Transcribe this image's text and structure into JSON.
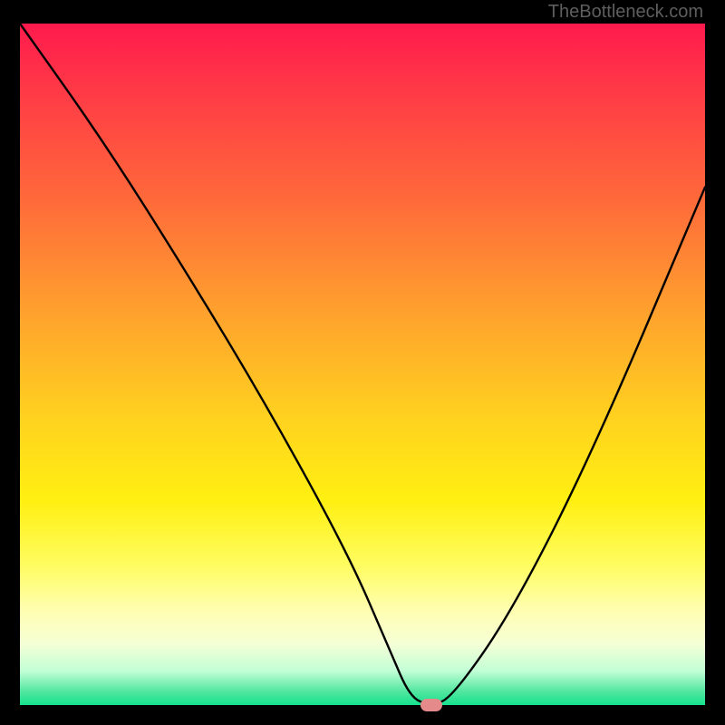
{
  "watermark": "TheBottleneck.com",
  "chart_data": {
    "type": "line",
    "title": "",
    "xlabel": "",
    "ylabel": "",
    "xlim": [
      0,
      100
    ],
    "ylim": [
      0,
      100
    ],
    "grid": false,
    "x": [
      0,
      12,
      24,
      36,
      48,
      54,
      57,
      60,
      63,
      72,
      84,
      100
    ],
    "values": [
      100,
      83,
      64,
      44,
      22,
      8,
      1,
      0,
      1,
      14,
      38,
      76
    ],
    "marker": {
      "x": 60,
      "y": 0
    },
    "background": "heat-gradient"
  }
}
